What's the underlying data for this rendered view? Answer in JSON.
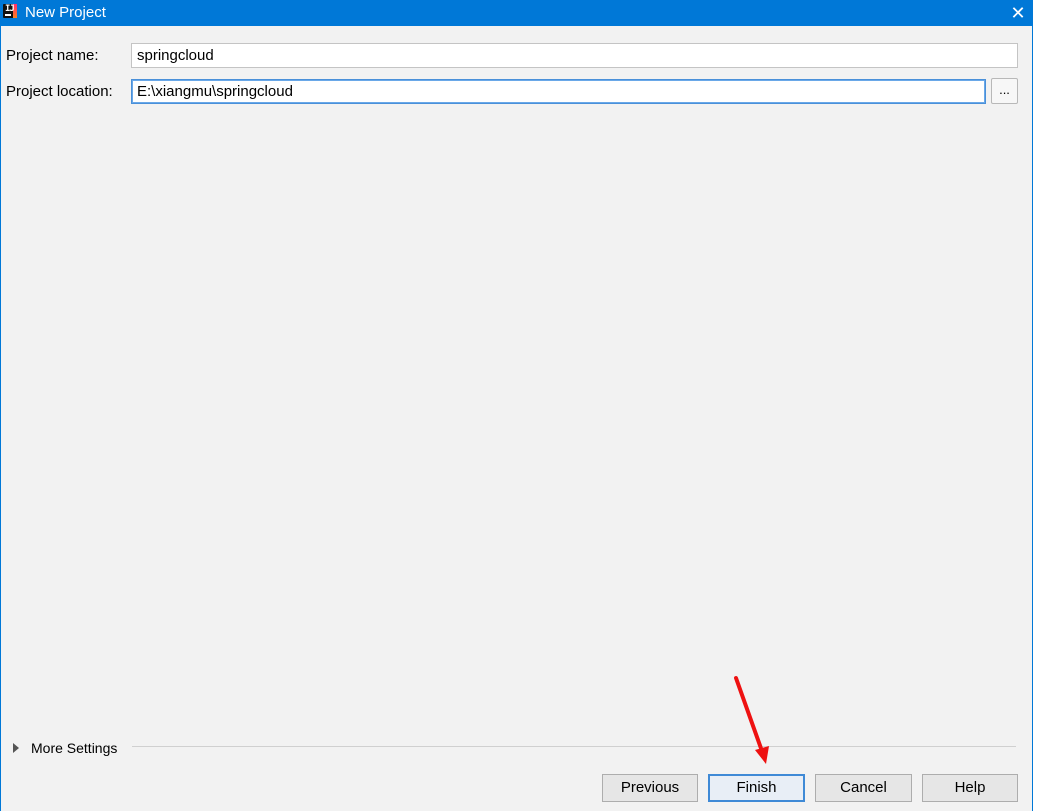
{
  "window": {
    "title": "New Project",
    "close_glyph": "✕",
    "app_icon": "intellij-idea-icon"
  },
  "form": {
    "name_label": "Project name:",
    "name_value": "springcloud",
    "location_label": "Project location:",
    "location_value": "E:\\xiangmu\\springcloud",
    "browse_label": "..."
  },
  "more_settings": {
    "label": "More Settings",
    "expanded": false
  },
  "buttons": {
    "previous": "Previous",
    "finish": "Finish",
    "cancel": "Cancel",
    "help": "Help"
  },
  "colors": {
    "titlebar": "#0078d7",
    "dialog_bg": "#f2f2f2",
    "annotation_arrow": "#ee1111"
  },
  "annotation": {
    "type": "red-arrow",
    "points_to": "finish-button"
  }
}
